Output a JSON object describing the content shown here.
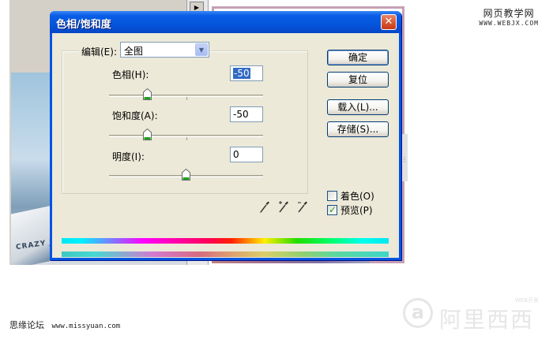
{
  "watermarks": {
    "top_title": "网页教学网",
    "top_url": "WWW.WEBJX.COM",
    "bottom_left": "思缘论坛",
    "bottom_left_url": "www.missyuan.com",
    "logo_letter": "a",
    "logo_text": "阿里西西",
    "logo_small": "WEB开发"
  },
  "background": {
    "plane_text": "CRAZY J",
    "nav_button": "▶"
  },
  "dialog": {
    "title": "色相/饱和度",
    "close": "✕",
    "edit_label": "编辑(E):",
    "edit_select_value": "全图",
    "hue": {
      "label": "色相(H):",
      "value": "-50",
      "slider_fraction": 0.25
    },
    "saturation": {
      "label": "饱和度(A):",
      "value": "-50",
      "slider_fraction": 0.25
    },
    "lightness": {
      "label": "明度(I):",
      "value": "0",
      "slider_fraction": 0.5
    },
    "buttons": {
      "ok": "确定",
      "reset": "复位",
      "load": "载入(L)...",
      "save": "存储(S)..."
    },
    "colorize": {
      "label": "着色(O)",
      "checked": false
    },
    "preview": {
      "label": "预览(P)",
      "checked": true
    },
    "eyedroppers": [
      "eyedropper-icon",
      "eyedropper-plus-icon",
      "eyedropper-minus-icon"
    ]
  }
}
